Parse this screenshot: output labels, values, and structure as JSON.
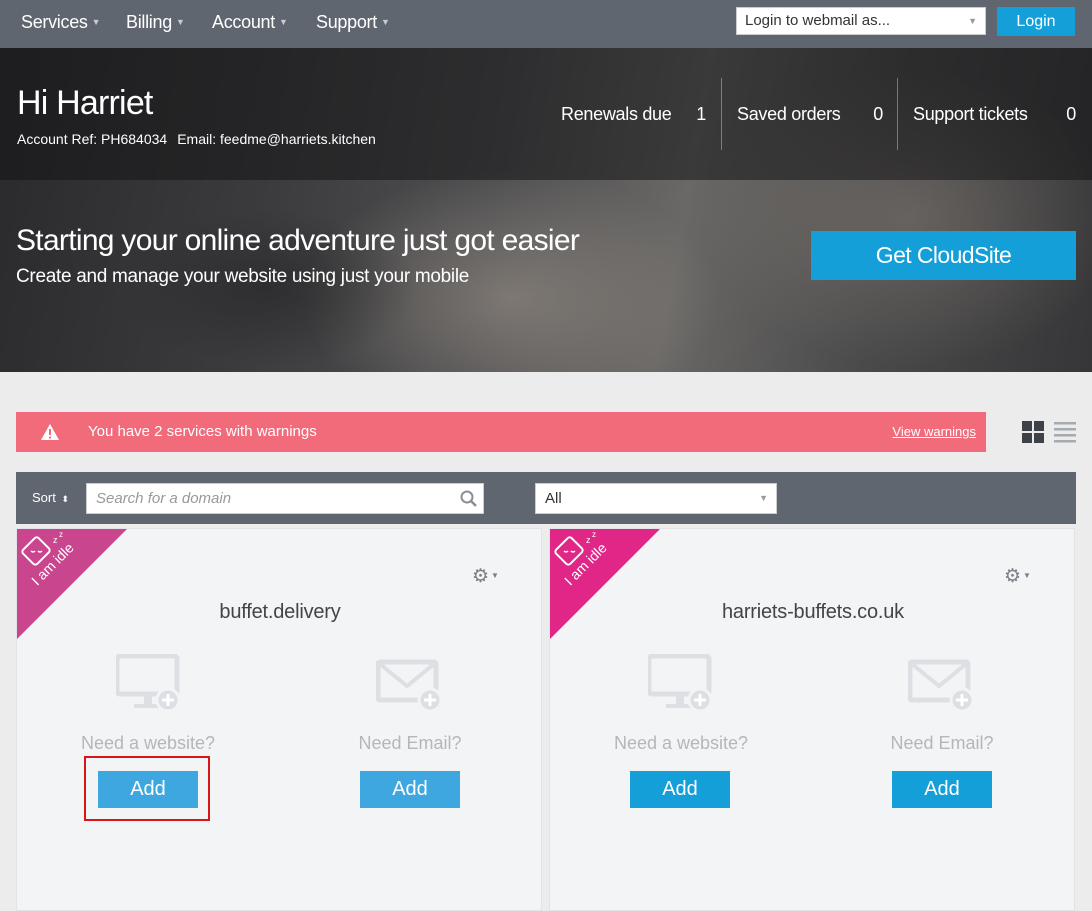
{
  "nav": {
    "items": [
      {
        "label": "Services"
      },
      {
        "label": "Billing"
      },
      {
        "label": "Account"
      },
      {
        "label": "Support"
      }
    ],
    "webmail_placeholder": "Login to webmail as...",
    "login_label": "Login"
  },
  "hero": {
    "greeting": "Hi Harriet",
    "account_ref": "Account Ref: PH684034",
    "email": "Email: feedme@harriets.kitchen",
    "stats": [
      {
        "label": "Renewals due",
        "value": "1"
      },
      {
        "label": "Saved orders",
        "value": "0"
      },
      {
        "label": "Support tickets",
        "value": "0"
      }
    ],
    "promo_title": "Starting your online adventure just got easier",
    "promo_subtitle": "Create and manage your website using just your mobile",
    "promo_button": "Get CloudSite"
  },
  "warnings": {
    "text": "You have 2 services with warnings",
    "link": "View warnings"
  },
  "filter": {
    "sort_label": "Sort",
    "search_placeholder": "Search for a domain",
    "filter_value": "All"
  },
  "cards": [
    {
      "ribbon": "I am idle",
      "ribbon_color": "#c9468f",
      "domain": "buffet.delivery",
      "website_label": "Need a website?",
      "website_button": "Add",
      "email_label": "Need Email?",
      "email_button": "Add"
    },
    {
      "ribbon": "I am idle",
      "ribbon_color": "#e02686",
      "domain": "harriets-buffets.co.uk",
      "website_label": "Need a website?",
      "website_button": "Add",
      "email_label": "Need Email?",
      "email_button": "Add"
    }
  ],
  "colors": {
    "nav_bg": "#5f6670",
    "accent": "#149fd9",
    "warning": "#f16b7b"
  }
}
